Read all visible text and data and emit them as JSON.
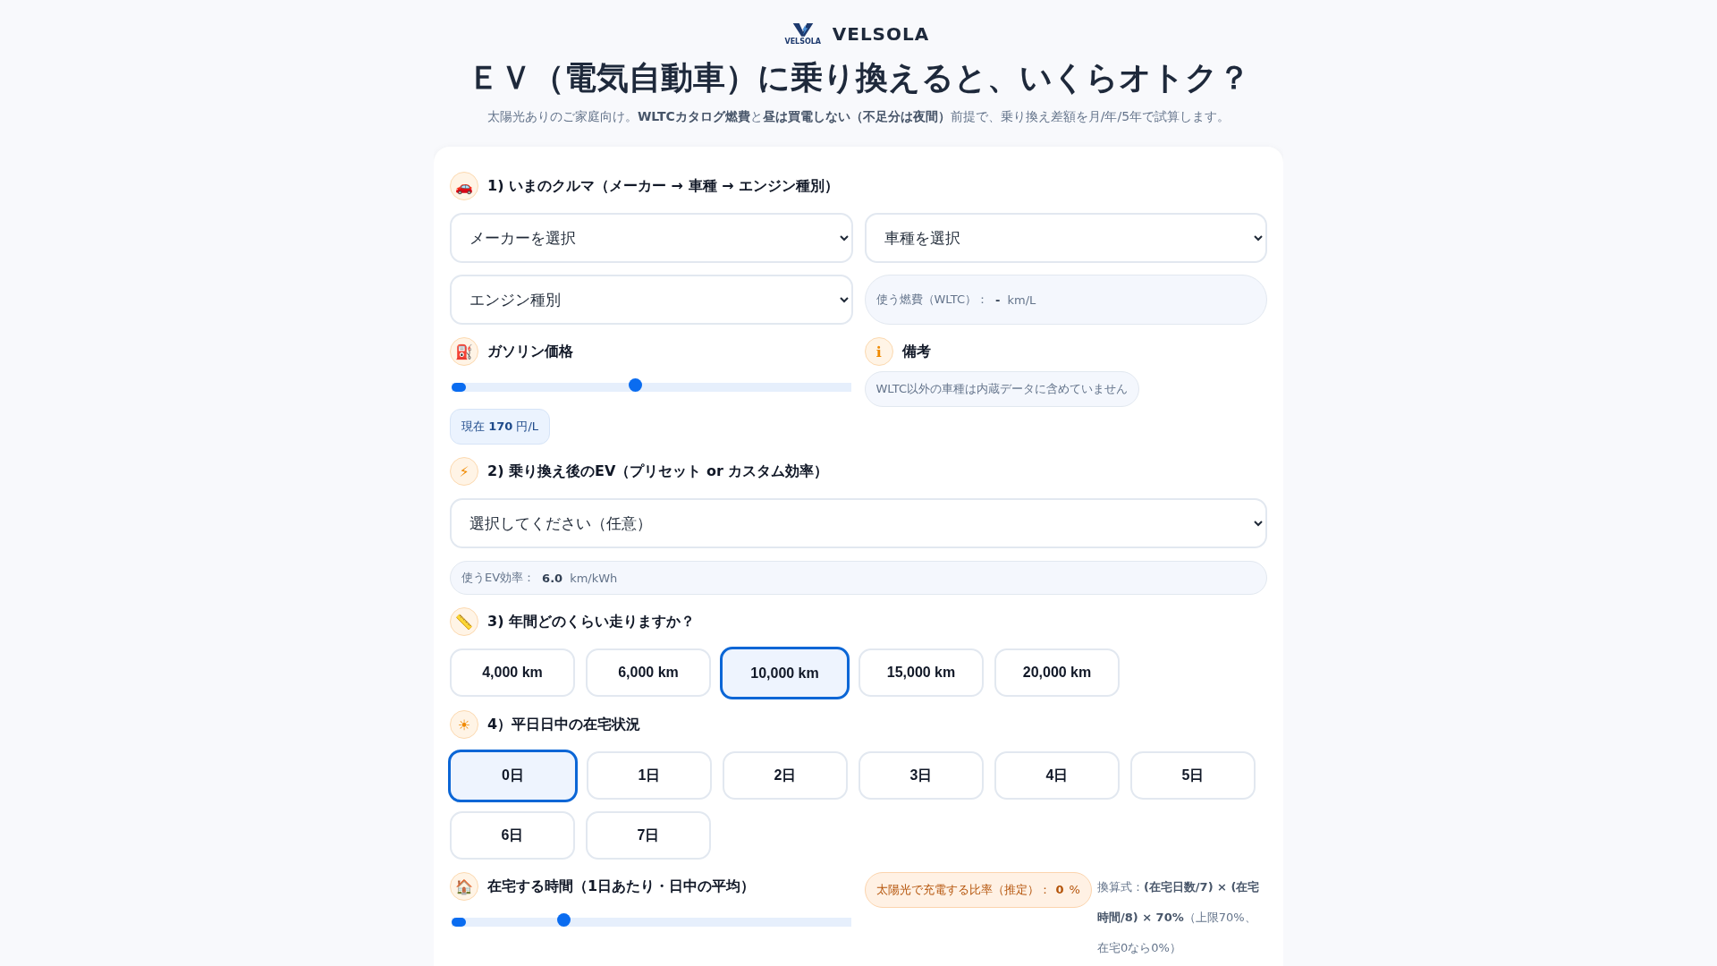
{
  "brand": {
    "name": "VELSOLA",
    "logo_text": "VELSOLA"
  },
  "title": "ＥＶ（電気自動車）に乗り換えると、いくらオトク？",
  "subtitle": "太陽光ありのご家庭向け。**WLTCカタログ燃費**と**昼は買電しない（不足分は夜間）**前提で、乗り換え差額を月/年/5年で試算します。",
  "car": {
    "icon": "🚗",
    "heading": "1) いまのクルマ（メーカー → 車種 → エンジン種別）",
    "maker_select": "メーカーを選択",
    "model_select": "車種を選択",
    "engine_select": "エンジン種別",
    "fuel_label": "使う燃費（WLTC）：",
    "fuel_value": "-",
    "fuel_unit": "km/L"
  },
  "gas": {
    "icon": "⛽",
    "heading": "ガソリン価格",
    "level": 0.46,
    "current_label": "現在",
    "current_value": "170",
    "current_unit": "円/L"
  },
  "note": {
    "icon": "ℹ",
    "heading": "備考",
    "text": "WLTC以外の車種は内蔵データに含めていません"
  },
  "ev": {
    "icon": "⚡",
    "heading": "2) 乗り換え後のEV（プリセット or カスタム効率）",
    "select": "選択してください（任意）",
    "eff_label": "使うEV効率：",
    "eff_value": "6.0",
    "eff_unit": "km/kWh"
  },
  "distance": {
    "icon": "📏",
    "heading": "3) 年間どのくらい走りますか？",
    "options": [
      {
        "label": "4,000 km",
        "selected": false
      },
      {
        "label": "6,000 km",
        "selected": false
      },
      {
        "label": "10,000 km",
        "selected": true
      },
      {
        "label": "15,000 km",
        "selected": false
      },
      {
        "label": "20,000 km",
        "selected": false
      }
    ]
  },
  "home_days": {
    "icon": "☀",
    "heading": "4）平日日中の在宅状況",
    "options": [
      {
        "label": "0日",
        "selected": true
      },
      {
        "label": "1日",
        "selected": false
      },
      {
        "label": "2日",
        "selected": false
      },
      {
        "label": "3日",
        "selected": false
      },
      {
        "label": "4日",
        "selected": false
      },
      {
        "label": "5日",
        "selected": false
      },
      {
        "label": "6日",
        "selected": false
      },
      {
        "label": "7日",
        "selected": false
      }
    ]
  },
  "home_hours": {
    "icon": "🏠",
    "heading": "在宅する時間（1日あたり・日中の平均）",
    "level": 0.28,
    "solar_label": "太陽光で充電する比率（推定）：",
    "solar_value": "0",
    "solar_unit": "%",
    "formula": "換算式：**(在宅日数/7) × (在宅時間/8) × 70%**（上限70%、在宅0なら0%）"
  }
}
